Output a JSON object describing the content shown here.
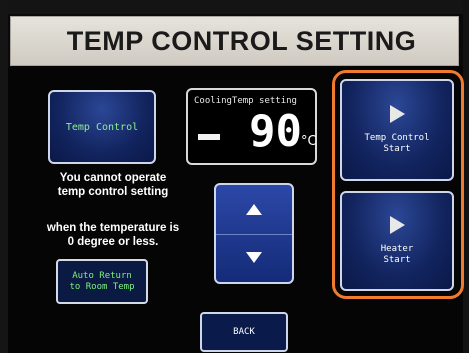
{
  "header": {
    "title": "TEMP CONTROL SETTING"
  },
  "left_panel": {
    "temp_control_label": "Temp Control",
    "info_line1": "You cannot operate",
    "info_line2": "temp control setting",
    "info_line3": "when the temperature is",
    "info_line4": "0 degree or less.",
    "auto_return_line1": "Auto Return",
    "auto_return_line2": "to Room Temp"
  },
  "cooling": {
    "label": "CoolingTemp setting",
    "value": "90",
    "unit": "°C"
  },
  "right_panel": {
    "temp_control_start_line1": "Temp Control",
    "temp_control_start_line2": "Start",
    "heater_start_line1": "Heater",
    "heater_start_line2": "Start"
  },
  "footer": {
    "back_label": "BACK"
  },
  "colors": {
    "highlight": "#f07a2e",
    "button_blue": "#12245e",
    "green_text": "#8ef08e",
    "title_bg": "#dcd9d2"
  },
  "icons": {
    "up": "triangle-up-icon",
    "down": "triangle-down-icon",
    "play": "play-icon",
    "minus": "minus-icon"
  }
}
